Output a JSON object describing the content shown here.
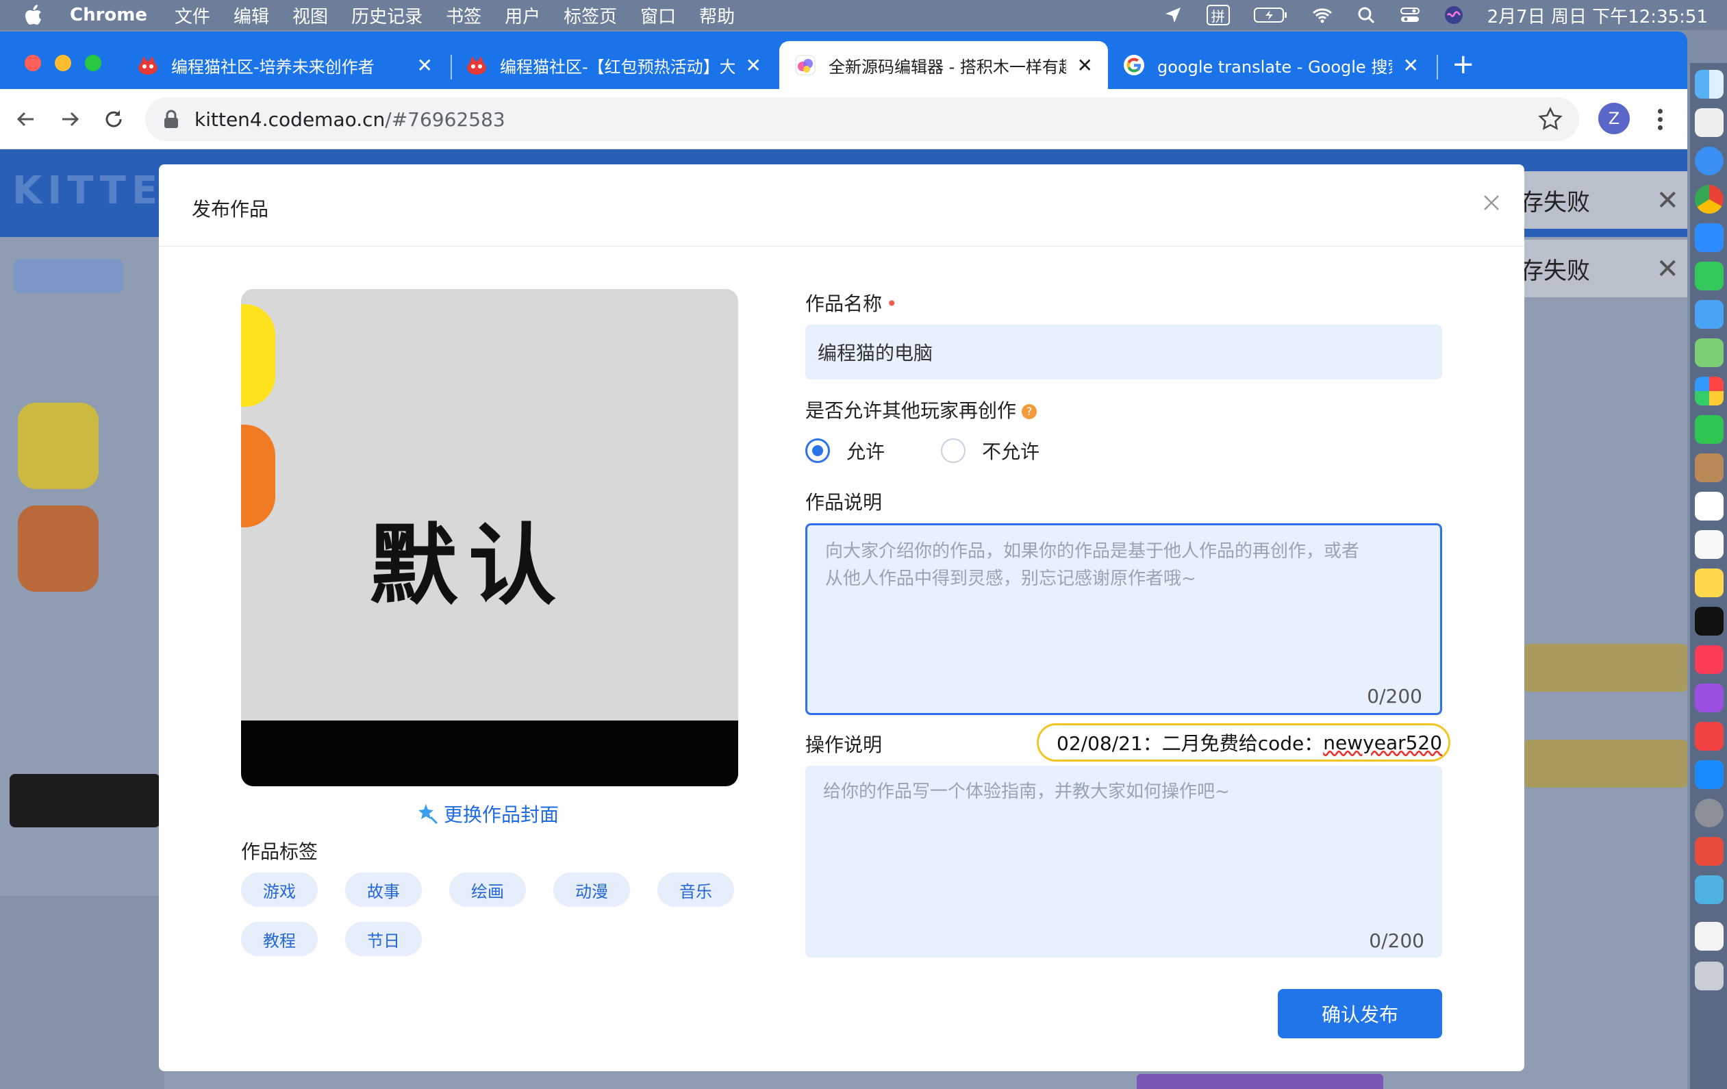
{
  "menubar": {
    "app_name": "Chrome",
    "items": [
      "文件",
      "编辑",
      "视图",
      "历史记录",
      "书签",
      "用户",
      "标签页",
      "窗口",
      "帮助"
    ],
    "input_method": "拼",
    "clock": "2月7日 周日 下午12:35:51"
  },
  "browser": {
    "tabs": [
      {
        "title": "编程猫社区-培养未来创作者",
        "icon": "codemao-favicon",
        "active": false
      },
      {
        "title": "编程猫社区-【红包预热活动】大",
        "icon": "codemao-favicon",
        "active": false
      },
      {
        "title": "全新源码编辑器 - 搭积木一样有趣",
        "icon": "kitten-favicon",
        "active": true
      },
      {
        "title": "google translate - Google 搜索",
        "icon": "google-favicon",
        "active": false
      }
    ],
    "new_tab": "+",
    "url_host": "kitten4.codemao.cn",
    "url_path": "/#76962583",
    "profile_initial": "Z"
  },
  "background_page": {
    "toasts": [
      "存失败",
      "存失败"
    ]
  },
  "modal": {
    "title": "发布作品",
    "cover_text": "默认",
    "change_cover": "更换作品封面",
    "tags_label": "作品标签",
    "tags": [
      "游戏",
      "故事",
      "绘画",
      "动漫",
      "音乐",
      "教程",
      "节日"
    ],
    "name_label": "作品名称",
    "name_value": "编程猫的电脑",
    "remix_label": "是否允许其他玩家再创作",
    "remix_help": "?",
    "remix_options": [
      "允许",
      "不允许"
    ],
    "remix_selected": "允许",
    "desc_label": "作品说明",
    "desc_placeholder_line1": "向大家介绍你的作品，如果你的作品是基于他人作品的再创作，或者",
    "desc_placeholder_line2": "从他人作品中得到灵感，别忘记感谢原作者哦~",
    "desc_counter": "0/200",
    "ops_label": "操作说明",
    "ops_placeholder": "给你的作品写一个体验指南，并教大家如何操作吧~",
    "ops_counter": "0/200",
    "note_prefix": "02/08/21：二月免费给code：",
    "note_code": "newyear520",
    "publish_button": "确认发布"
  },
  "colors": {
    "brand_blue": "#1a73e8",
    "primary": "#2275e8",
    "input_bg": "#e8f0fd",
    "note_border": "#f3c625"
  }
}
